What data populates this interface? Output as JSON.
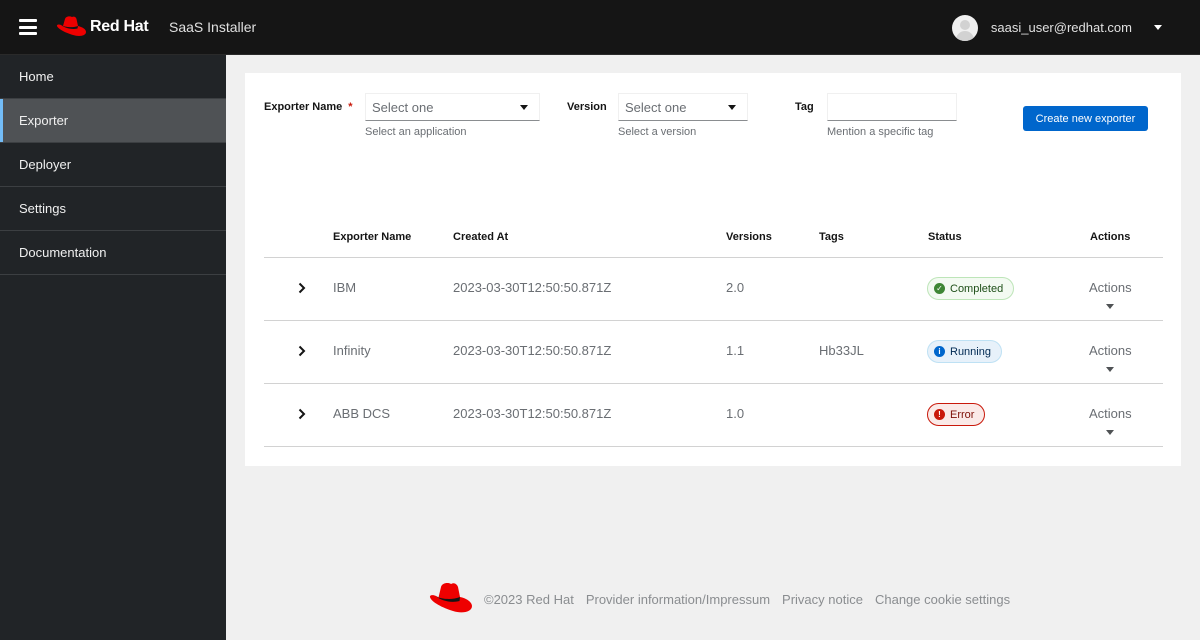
{
  "header": {
    "brand": "Red Hat",
    "product": "SaaS Installer",
    "user": "saasi_user@redhat.com"
  },
  "sidebar": {
    "items": [
      {
        "label": "Home",
        "active": false
      },
      {
        "label": "Exporter",
        "active": true
      },
      {
        "label": "Deployer",
        "active": false
      },
      {
        "label": "Settings",
        "active": false
      },
      {
        "label": "Documentation",
        "active": false
      }
    ]
  },
  "form": {
    "exporter_name": {
      "label": "Exporter Name",
      "required_mark": "*",
      "value": "Select one",
      "helper": "Select an application"
    },
    "version": {
      "label": "Version",
      "value": "Select one",
      "helper": "Select a version"
    },
    "tag": {
      "label": "Tag",
      "value": "",
      "placeholder": "",
      "helper": "Mention a specific tag"
    },
    "create_button": "Create new exporter"
  },
  "table": {
    "columns": [
      "Exporter Name",
      "Created At",
      "Versions",
      "Tags",
      "Status",
      "Actions"
    ],
    "rows": [
      {
        "name": "IBM",
        "created_at": "2023-03-30T12:50:50.871Z",
        "version": "2.0",
        "tags": "",
        "status": "Completed",
        "status_icon": "check-circle",
        "actions": "Actions"
      },
      {
        "name": "Infinity",
        "created_at": "2023-03-30T12:50:50.871Z",
        "version": "1.1",
        "tags": "Hb33JL",
        "status": "Running",
        "status_icon": "info-circle",
        "actions": "Actions"
      },
      {
        "name": "ABB DCS",
        "created_at": "2023-03-30T12:50:50.871Z",
        "version": "1.0",
        "tags": "",
        "status": "Error",
        "status_icon": "exclamation-circle",
        "actions": "Actions"
      }
    ]
  },
  "footer": {
    "copyright": "©2023 Red Hat",
    "links": [
      "Provider information/Impressum",
      "Privacy notice",
      "Change cookie settings"
    ]
  },
  "colors": {
    "masthead": "#151515",
    "sidebar": "#212427",
    "sidebar_active": "#4f5255",
    "sidebar_active_accent": "#73bcf7",
    "primary": "#0066cc",
    "success": "#3e8635",
    "info": "#0066cc",
    "danger": "#c9190b",
    "brand_red": "#ee0000"
  }
}
